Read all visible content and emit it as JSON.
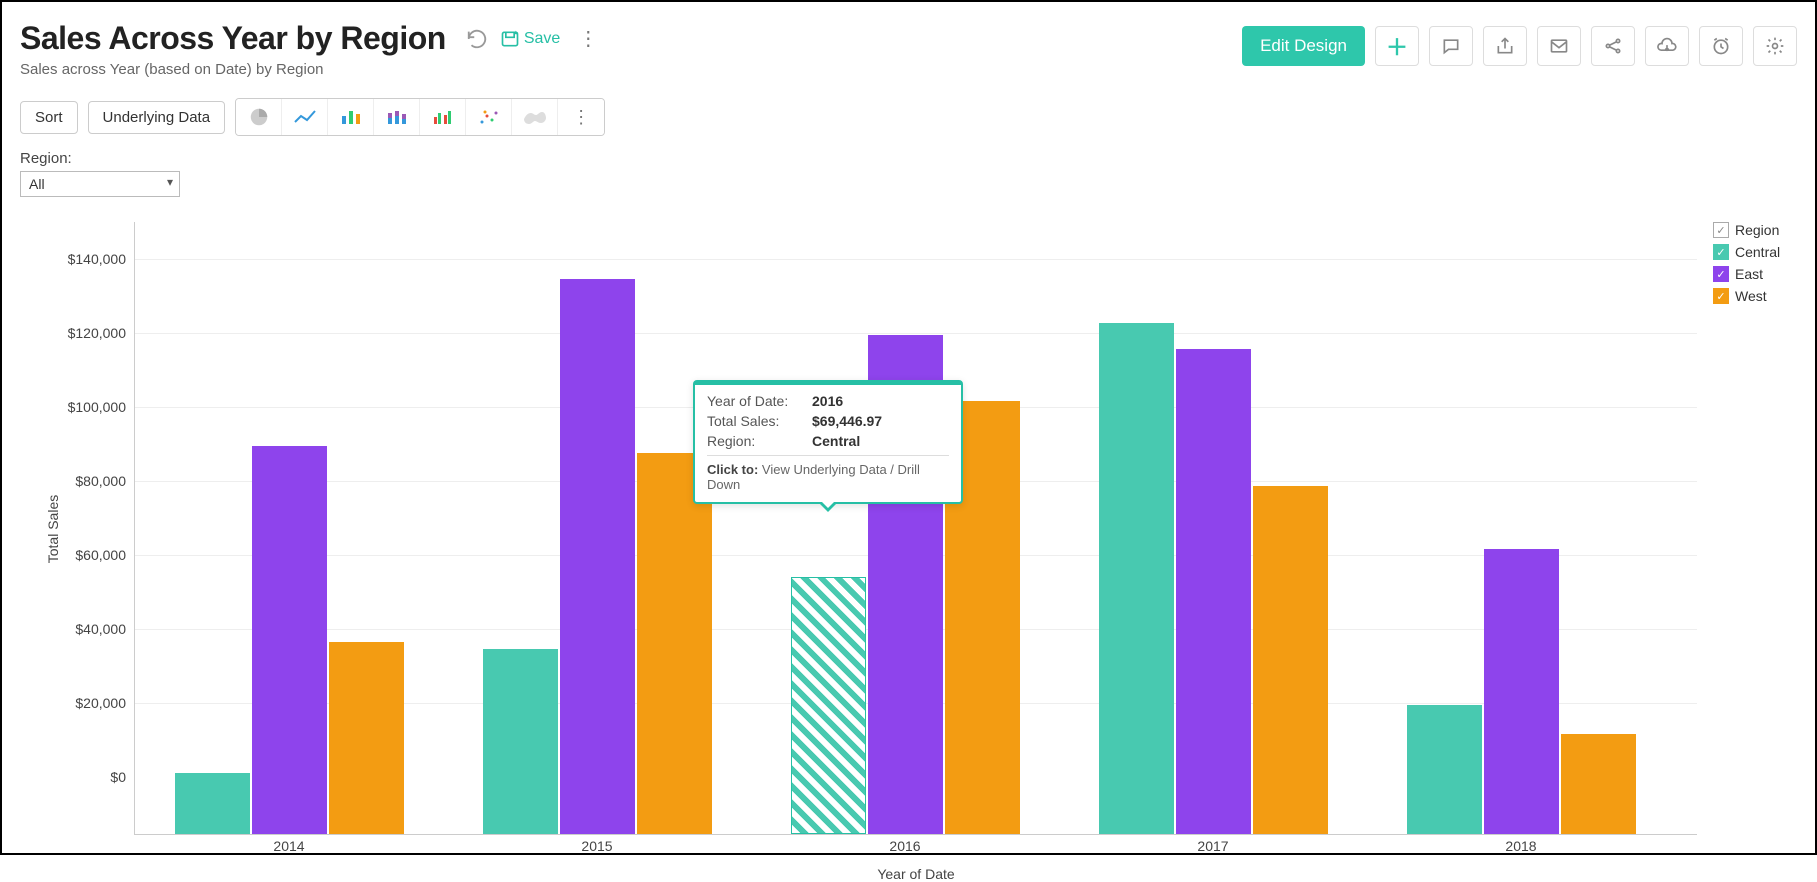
{
  "header": {
    "title": "Sales Across Year by Region",
    "subtitle": "Sales across Year (based on Date) by Region",
    "save_label": "Save",
    "edit_design_label": "Edit Design"
  },
  "toolbar": {
    "sort_label": "Sort",
    "underlying_label": "Underlying Data"
  },
  "filter": {
    "label": "Region:",
    "value": "All"
  },
  "legend": {
    "title": "Region",
    "items": [
      {
        "name": "Central",
        "color": "#48c9b0"
      },
      {
        "name": "East",
        "color": "#8e44ec"
      },
      {
        "name": "West",
        "color": "#f39c12"
      }
    ]
  },
  "tooltip": {
    "rows": [
      {
        "k": "Year of Date:",
        "v": "2016"
      },
      {
        "k": "Total Sales:",
        "v": "$69,446.97"
      },
      {
        "k": "Region:",
        "v": "Central"
      }
    ],
    "action_prefix": "Click to:",
    "action_text": "View Underlying Data / Drill Down"
  },
  "chart_data": {
    "type": "bar",
    "title": "Sales Across Year by Region",
    "xlabel": "Year of Date",
    "ylabel": "Total Sales",
    "ylim": [
      0,
      150000
    ],
    "yticks": [
      0,
      20000,
      40000,
      60000,
      80000,
      100000,
      120000,
      140000
    ],
    "ytick_labels": [
      "$0",
      "$20,000",
      "$40,000",
      "$60,000",
      "$80,000",
      "$100,000",
      "$120,000",
      "$140,000"
    ],
    "categories": [
      "2014",
      "2015",
      "2016",
      "2017",
      "2018"
    ],
    "series": [
      {
        "name": "Central",
        "color": "#48c9b0",
        "values": [
          16500,
          50000,
          69446.97,
          138000,
          35000
        ]
      },
      {
        "name": "East",
        "color": "#8e44ec",
        "values": [
          105000,
          150000,
          135000,
          131000,
          77000
        ]
      },
      {
        "name": "West",
        "color": "#f39c12",
        "values": [
          52000,
          103000,
          117000,
          94000,
          27000
        ]
      }
    ],
    "highlighted": {
      "series": "Central",
      "category": "2016"
    }
  }
}
